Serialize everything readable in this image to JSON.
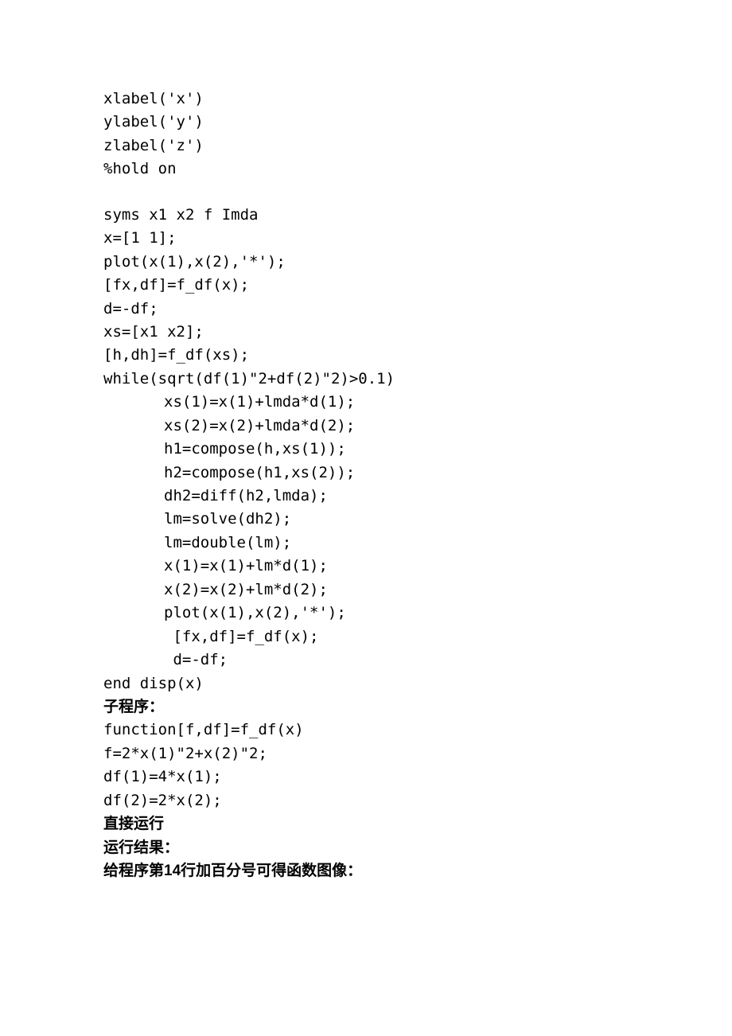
{
  "code": {
    "l1": "xlabel('x')",
    "l2": "ylabel('y')",
    "l3": "zlabel('z')",
    "l4": "%hold on",
    "l5": "syms x1 x2 f Imda",
    "l6": "x=[1 1];",
    "l7": "plot(x(1),x(2),'*');",
    "l8": "[fx,df]=f_df(x);",
    "l9": "d=-df;",
    "l10": "xs=[x1 x2];",
    "l11": "[h,dh]=f_df(xs);",
    "l12": "while(sqrt(df(1)\"2+df(2)\"2)>0.1)",
    "l13": "xs(1)=x(1)+lmda*d(1);",
    "l14": "xs(2)=x(2)+lmda*d(2);",
    "l15": "h1=compose(h,xs(1));",
    "l16": "h2=compose(h1,xs(2));",
    "l17": "dh2=diff(h2,lmda);",
    "l18": "lm=solve(dh2);",
    "l19": "lm=double(lm);",
    "l20": "x(1)=x(1)+lm*d(1);",
    "l21": "x(2)=x(2)+lm*d(2);",
    "l22": "plot(x(1),x(2),'*');",
    "l23": " [fx,df]=f_df(x);",
    "l24": " d=-df;",
    "l25": "end disp(x)"
  },
  "headings": {
    "sub": "子程序：",
    "run1": "直接运行",
    "run2": "运行结果：",
    "note": "给程序第14行加百分号可得函数图像："
  },
  "sub": {
    "s1": "function[f,df]=f_df(x)",
    "s2": "f=2*x(1)\"2+x(2)\"2;",
    "s3": "df(1)=4*x(1);",
    "s4": "df(2)=2*x(2);"
  }
}
